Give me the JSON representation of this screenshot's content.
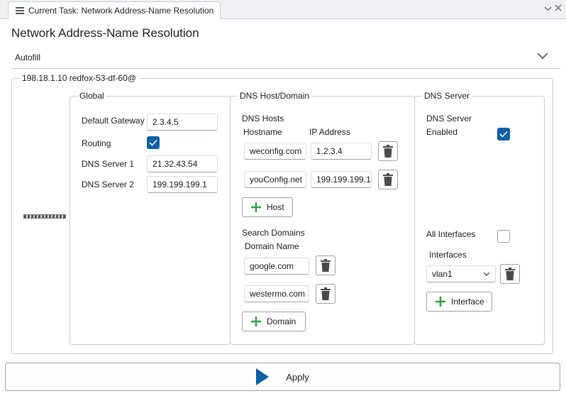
{
  "tab": {
    "title": "Current Task: Network Address-Name Resolution",
    "icon": "list-icon"
  },
  "page": {
    "title": "Network Address-Name Resolution"
  },
  "autofill": {
    "label": "Autofill"
  },
  "device": {
    "title": "198.18.1.10 redfox-53-df-60@"
  },
  "global": {
    "title": "Global",
    "default_gateway_label": "Default Gateway",
    "default_gateway_value": "2.3.4.5",
    "routing_label": "Routing",
    "routing_checked": true,
    "dns1_label": "DNS Server 1",
    "dns1_value": "21.32.43.54",
    "dns2_label": "DNS Server 2",
    "dns2_value": "199.199.199.1"
  },
  "dns_host_domain": {
    "title": "DNS Host/Domain",
    "hosts_label": "DNS Hosts",
    "col_hostname": "Hostname",
    "col_ip": "IP Address",
    "hosts": [
      {
        "hostname": "weconfig.com",
        "ip": "1.2.3.4"
      },
      {
        "hostname": "youConfig.net",
        "ip": "199.199.199.1"
      }
    ],
    "add_host_label": "Host",
    "search_domains_label": "Search Domains",
    "domain_name_label": "Domain Name",
    "domains": [
      "google.com",
      "westermo.com"
    ],
    "add_domain_label": "Domain"
  },
  "dns_server": {
    "title": "DNS Server",
    "enabled_label_line1": "DNS Server",
    "enabled_label_line2": "Enabled",
    "enabled_checked": true,
    "all_interfaces_label": "All Interfaces",
    "all_interfaces_checked": false,
    "interfaces_label": "Interfaces",
    "interface_selected": "vlan1",
    "add_interface_label": "Interface"
  },
  "apply": {
    "label": "Apply"
  },
  "colors": {
    "accent": "#0f5fa6",
    "add_green": "#2e9e3e",
    "trash": "#4a4a4a"
  }
}
